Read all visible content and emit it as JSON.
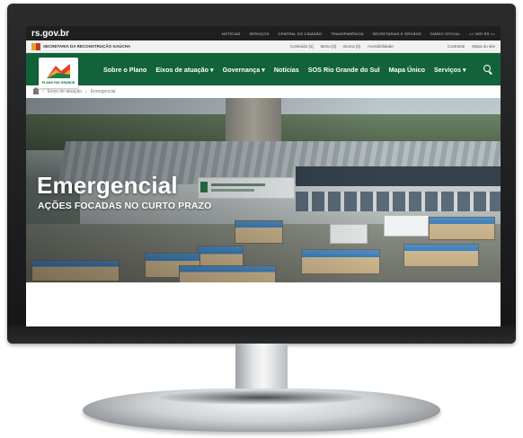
{
  "site": {
    "brand": "rs.gov.br",
    "top_links": [
      "NOTÍCIAS",
      "SERVIÇOS",
      "CENTRAL DO CIDADÃO",
      "TRANSPARÊNCIA",
      "SECRETARIAS E ÓRGÃOS",
      "DIÁRIO OFICIAL",
      ">> VER RS <<"
    ]
  },
  "gov_bar": {
    "secretariat": "SECRETARIA DA RECONSTRUÇÃO GAÚCHA",
    "accessibility": [
      "Conteúdo [1]",
      "Menu [2]",
      "Busca [3]",
      "Acessibilidade"
    ],
    "right_links": [
      "Contraste",
      "Mapa do site"
    ]
  },
  "main_nav": {
    "logo_text": "PLANO RIO GRANDE",
    "items": [
      "Sobre o Plano",
      "Eixos de atuação ▾",
      "Governança ▾",
      "Notícias",
      "SOS Rio Grande do Sul",
      "Mapa Único",
      "Serviços ▾"
    ]
  },
  "breadcrumb": {
    "items": [
      "›",
      "Eixos de atuação",
      "›",
      "Emergencial"
    ]
  },
  "hero": {
    "title": "Emergencial",
    "subtitle": "AÇÕES FOCADAS NO CURTO PRAZO"
  },
  "colors": {
    "nav_green": "#12633a",
    "topbar": "#1f1f1f"
  }
}
